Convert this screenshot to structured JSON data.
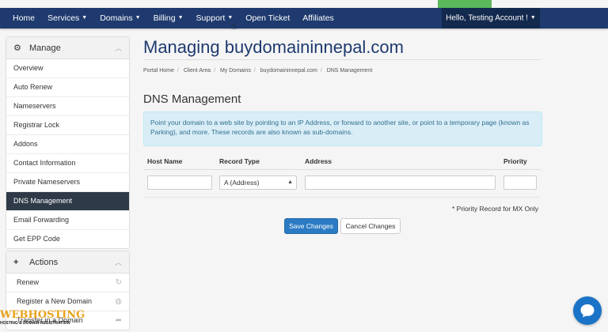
{
  "nav": {
    "items": [
      {
        "label": "Home",
        "dropdown": false
      },
      {
        "label": "Services",
        "dropdown": true
      },
      {
        "label": "Domains",
        "dropdown": true
      },
      {
        "label": "Billing",
        "dropdown": true
      },
      {
        "label": "Support",
        "dropdown": true
      },
      {
        "label": "Open Ticket",
        "dropdown": false
      },
      {
        "label": "Affiliates",
        "dropdown": false
      }
    ],
    "account": "Hello, Testing Account !"
  },
  "sidebar": {
    "manage": {
      "title": "Manage",
      "items": [
        {
          "label": "Overview",
          "active": false
        },
        {
          "label": "Auto Renew",
          "active": false
        },
        {
          "label": "Nameservers",
          "active": false
        },
        {
          "label": "Registrar Lock",
          "active": false
        },
        {
          "label": "Addons",
          "active": false
        },
        {
          "label": "Contact Information",
          "active": false
        },
        {
          "label": "Private Nameservers",
          "active": false
        },
        {
          "label": "DNS Management",
          "active": true
        },
        {
          "label": "Email Forwarding",
          "active": false
        },
        {
          "label": "Get EPP Code",
          "active": false
        }
      ]
    },
    "actions": {
      "title": "Actions",
      "items": [
        {
          "label": "Renew",
          "icon": "refresh-icon"
        },
        {
          "label": "Register a New Domain",
          "icon": "globe-icon"
        },
        {
          "label": "Transfer in a Domain",
          "icon": "share-icon"
        }
      ]
    }
  },
  "main": {
    "title": "Managing buydomaininnepal.com",
    "breadcrumb": [
      "Portal Home",
      "Client Area",
      "My Domains",
      "buydomaininnepal.com",
      "DNS Management"
    ],
    "section_title": "DNS Management",
    "info": "Point your domain to a web site by pointing to an IP Address, or forward to another site, or point to a temporary page (known as Parking), and more. These records are also known as sub-domains.",
    "table": {
      "headers": {
        "host": "Host Name",
        "type": "Record Type",
        "address": "Address",
        "priority": "Priority"
      },
      "record_type_value": "A (Address)"
    },
    "priority_note": "* Priority Record for MX Only",
    "save_label": "Save Changes",
    "cancel_label": "Cancel Changes"
  },
  "footer": {
    "logo_main": "WEBHOSTING",
    "logo_sub": "HOSTING & DOMAIN REGISTRATION"
  },
  "colors": {
    "nav_bg": "#1e3a6e",
    "accent_green": "#5cb85c",
    "primary_button": "#2b7bc4",
    "active_menu": "#2e3a47",
    "info_bg": "#d9edf7"
  }
}
